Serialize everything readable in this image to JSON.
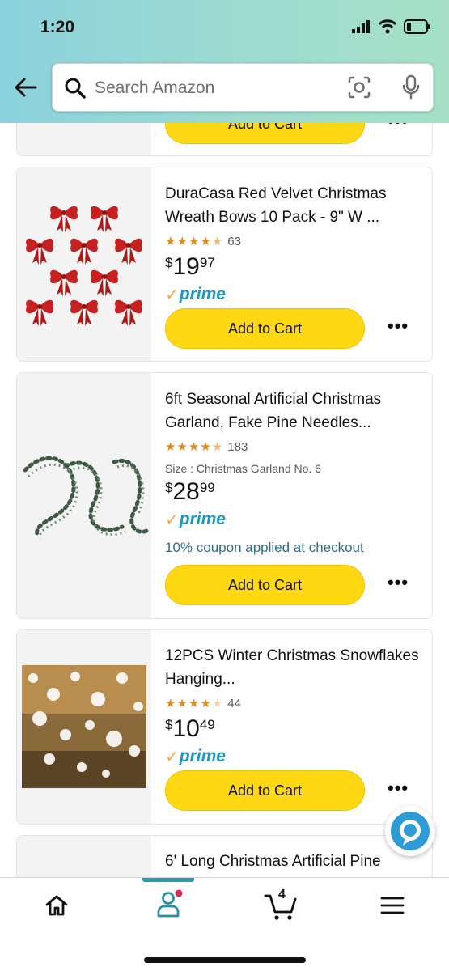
{
  "status_bar": {
    "time": "1:20"
  },
  "search": {
    "placeholder": "Search Amazon"
  },
  "colors": {
    "header_gradient_start": "#8bd2dc",
    "header_gradient_end": "#a5e0c6",
    "button_yellow": "#ffd814",
    "prime_blue": "#1a98c9",
    "star_orange": "#e08a1e",
    "coupon_teal": "#2b6d8d"
  },
  "partial_card": {
    "add_to_cart": "Add to Cart",
    "more": "•••"
  },
  "products": [
    {
      "title": "DuraCasa Red Velvet Christmas Wreath Bows 10 Pack - 9\" W ...",
      "rating": 4.5,
      "review_count": "63",
      "price_symbol": "$",
      "price_whole": "19",
      "price_fraction": "97",
      "prime": "prime",
      "add_to_cart": "Add to Cart",
      "more": "•••"
    },
    {
      "title": "6ft Seasonal Artificial Christmas Garland, Fake Pine Needles...",
      "rating": 4.5,
      "review_count": "183",
      "size": "Size : Christmas Garland No. 6",
      "price_symbol": "$",
      "price_whole": "28",
      "price_fraction": "99",
      "prime": "prime",
      "coupon": "10% coupon applied at checkout",
      "add_to_cart": "Add to Cart",
      "more": "•••"
    },
    {
      "title": "12PCS Winter Christmas Snowflakes Hanging...",
      "rating": 4.0,
      "review_count": "44",
      "price_symbol": "$",
      "price_whole": "10",
      "price_fraction": "49",
      "prime": "prime",
      "add_to_cart": "Add to Cart",
      "more": "•••"
    },
    {
      "title": "6' Long Christmas Artificial Pine"
    }
  ],
  "bottom_nav": {
    "cart_count": "4",
    "items": [
      "home-icon",
      "account-icon",
      "cart-icon",
      "menu-icon"
    ]
  }
}
